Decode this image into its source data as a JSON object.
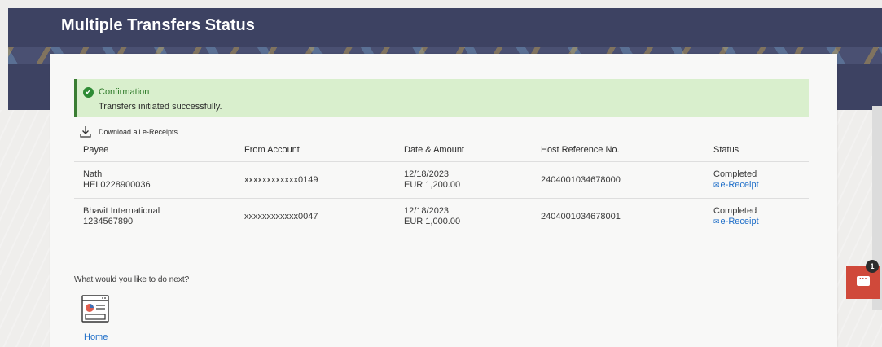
{
  "page": {
    "title": "Multiple Transfers Status"
  },
  "confirmation": {
    "title": "Confirmation",
    "message": "Transfers initiated successfully."
  },
  "download": {
    "label": "Download all e-Receipts"
  },
  "table": {
    "headers": {
      "payee": "Payee",
      "from_account": "From Account",
      "date_amount": "Date & Amount",
      "host_ref": "Host Reference No.",
      "status": "Status"
    },
    "rows": [
      {
        "payee_name": "Nath",
        "payee_id": "HEL0228900036",
        "from_account": "xxxxxxxxxxxx0149",
        "date": "12/18/2023",
        "amount": "EUR 1,200.00",
        "host_ref": "2404001034678000",
        "status": "Completed",
        "receipt_link": "e-Receipt"
      },
      {
        "payee_name": "Bhavit International",
        "payee_id": "1234567890",
        "from_account": "xxxxxxxxxxxx0047",
        "date": "12/18/2023",
        "amount": "EUR 1,000.00",
        "host_ref": "2404001034678001",
        "status": "Completed",
        "receipt_link": "e-Receipt"
      }
    ]
  },
  "next": {
    "question": "What would you like to do next?",
    "home_label": "Home"
  },
  "chat": {
    "badge_count": "1"
  },
  "colors": {
    "header_bg": "#3d4262",
    "success_bg": "#d9efcd",
    "success_accent": "#3a7d33",
    "link": "#1e6ec8",
    "chat_button": "#d0493a"
  },
  "icons": [
    "check-circle-icon",
    "download-icon",
    "receipt-icon",
    "home-dashboard-icon",
    "chat-icon"
  ]
}
